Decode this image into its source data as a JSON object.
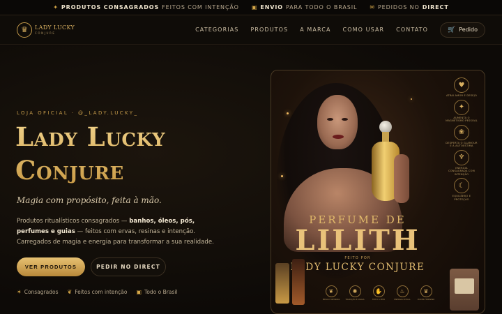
{
  "announcement": [
    {
      "icon": "star-icon",
      "glyph": "✦",
      "bold": "PRODUTOS CONSAGRADOS",
      "rest": "FEITOS COM INTENÇÃO"
    },
    {
      "icon": "box-icon",
      "glyph": "▣",
      "bold": "ENVIO",
      "rest": "PARA TODO O BRASIL"
    },
    {
      "icon": "chat-icon",
      "glyph": "✉",
      "bold": "",
      "rest": "PEDIDOS NO",
      "tail": "DIRECT"
    }
  ],
  "logo": {
    "line1": "LADY LUCKY",
    "line2": "CONJURE",
    "glyph": "♛"
  },
  "nav": {
    "items": [
      "CATEGORIAS",
      "PRODUTOS",
      "A MARCA",
      "COMO USAR",
      "CONTATO"
    ],
    "order_label": "Pedido"
  },
  "hero": {
    "eyebrow": "LOJA OFICIAL · @_LADY.LUCKY_",
    "title_line1": "Lady Lucky",
    "title_line2": "Conjure",
    "tagline": "Magia com propósito, feita à mão.",
    "desc_prefix": "Produtos ritualísticos consagrados — ",
    "desc_bold": "banhos, óleos, pós, perfumes e guias",
    "desc_suffix": " — feitos com ervas, resinas e intenção. Carregados de magia e energia para transformar a sua realidade.",
    "primary_button": "VER PRODUTOS",
    "secondary_button": "PEDIR NO DIRECT",
    "badges": [
      {
        "icon": "sparkle-icon",
        "glyph": "✶",
        "label": "Consagrados"
      },
      {
        "icon": "leaf-icon",
        "glyph": "❦",
        "label": "Feitos com intenção"
      },
      {
        "icon": "box-icon",
        "glyph": "▣",
        "label": "Todo o Brasil"
      }
    ]
  },
  "product": {
    "title_small": "PERFUME DE",
    "title_big": "LILITH",
    "made_by": "FEITO POR",
    "brand": "LADY LUCKY CONJURE",
    "side_items": [
      {
        "icon": "heart-icon",
        "glyph": "♥",
        "label": "ATRAI AMOR E DESEJO"
      },
      {
        "icon": "star-icon",
        "glyph": "✦",
        "label": "AUMENTA O MAGNETISMO PESSOAL"
      },
      {
        "icon": "rose-icon",
        "glyph": "❀",
        "label": "DESPERTA O GLAMOUR E A AUTOESTIMA"
      },
      {
        "icon": "candle-icon",
        "glyph": "♆",
        "label": "ENERGIA CONSAGRADA COM INTENÇÃO"
      },
      {
        "icon": "moon-icon",
        "glyph": "☾",
        "label": "EQUILÍBRIO E PROTEÇÃO"
      }
    ],
    "bottom_items": [
      {
        "icon": "herb-icon",
        "glyph": "❦",
        "label": "ERVAS E RESINAS"
      },
      {
        "icon": "sun-icon",
        "glyph": "✺",
        "label": "TRADIÇÃO E MAGIA"
      },
      {
        "icon": "hand-icon",
        "glyph": "✋",
        "label": "FEITO À MÃO"
      },
      {
        "icon": "flame-icon",
        "glyph": "♨",
        "label": "ENERGIA RITUAL"
      },
      {
        "icon": "crown-icon",
        "glyph": "♛",
        "label": "PODER FEMININO"
      }
    ]
  }
}
